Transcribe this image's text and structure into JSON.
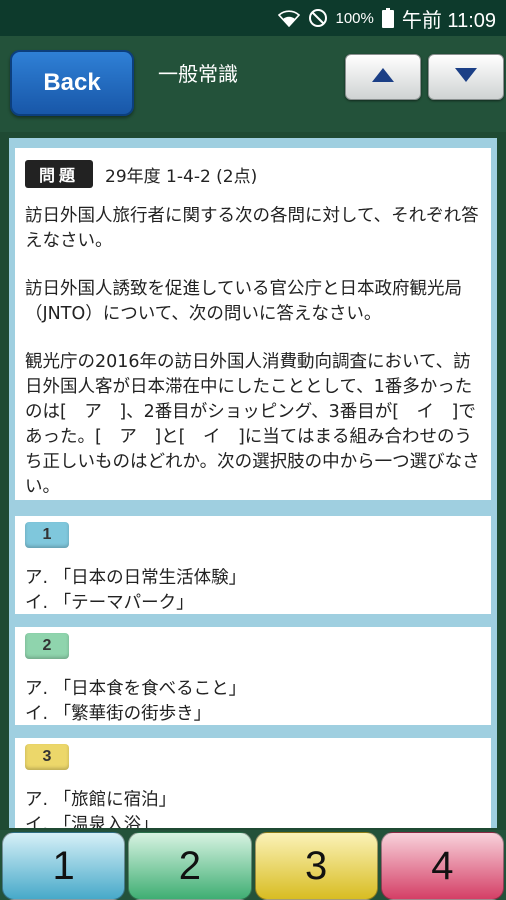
{
  "status_bar": {
    "icons": [
      "wifi-icon",
      "no-disturb-icon",
      "battery-icon"
    ],
    "battery": "100%",
    "time": "午前 11:09"
  },
  "header": {
    "back_label": "Back",
    "title": "一般常識",
    "up_icon": "triangle-up-icon",
    "down_icon": "triangle-down-icon"
  },
  "question": {
    "badge": "問題",
    "info": "29年度  1-4-2  (2点)",
    "paragraphs": [
      "訪日外国人旅行者に関する次の各問に対して、それぞれ答えなさい。",
      "訪日外国人誘致を促進している官公庁と日本政府観光局（JNTO）について、次の問いに答えなさい。",
      "観光庁の2016年の訪日外国人消費動向調査において、訪日外国人客が日本滞在中にしたこととして、1番多かったのは[　ア　]、2番目がショッピング、3番目が[　イ　]であった。[　ア　]と[　イ　]に当てはまる組み合わせのうち正しいものはどれか。次の選択肢の中から一つ選びなさい。"
    ]
  },
  "choices": [
    {
      "number": "1",
      "line_a": "ア. 「日本の日常生活体験」",
      "line_b": "イ. 「テーマパーク」",
      "color": "#7fc7dc"
    },
    {
      "number": "2",
      "line_a": "ア. 「日本食を食べること」",
      "line_b": "イ. 「繁華街の街歩き」",
      "color": "#8fd4ad"
    },
    {
      "number": "3",
      "line_a": "ア. 「旅館に宿泊」",
      "line_b": "イ. 「温泉入浴」",
      "color": "#ecd76a"
    }
  ],
  "answer_buttons": [
    {
      "label": "1",
      "color_top": "#d6f0f7",
      "color_bottom": "#47a9c9"
    },
    {
      "label": "2",
      "color_top": "#d7f3e2",
      "color_bottom": "#3fae73"
    },
    {
      "label": "3",
      "color_top": "#fbf2b8",
      "color_bottom": "#d8bd22"
    },
    {
      "label": "4",
      "color_top": "#f8d2db",
      "color_bottom": "#d43f66"
    }
  ]
}
